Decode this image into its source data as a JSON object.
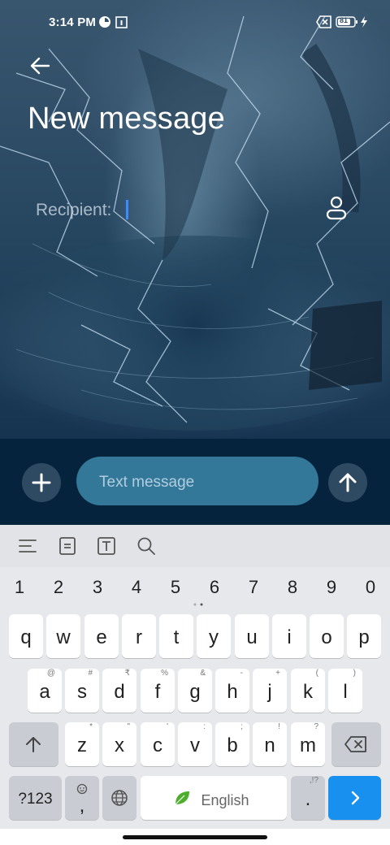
{
  "status_bar": {
    "time": "3:14 PM",
    "battery": "81",
    "icons": [
      "data-saver-icon",
      "calendar-icon",
      "sim-off-icon",
      "battery-icon",
      "charging-icon"
    ]
  },
  "header": {
    "title": "New message",
    "back_icon": "back-arrow-icon"
  },
  "recipient": {
    "label": "Recipient:",
    "value": "",
    "contact_icon": "contact-person-icon"
  },
  "compose": {
    "placeholder": "Text message",
    "attach_icon": "plus-icon",
    "send_icon": "send-arrow-icon"
  },
  "keyboard": {
    "toolbar_icons": [
      "menu-icon",
      "clipboard-icon",
      "text-format-icon",
      "search-icon"
    ],
    "numbers": [
      "1",
      "2",
      "3",
      "4",
      "5",
      "6",
      "7",
      "8",
      "9",
      "0"
    ],
    "row1": [
      "q",
      "w",
      "e",
      "r",
      "t",
      "y",
      "u",
      "i",
      "o",
      "p"
    ],
    "row2": [
      {
        "k": "a",
        "s": "@"
      },
      {
        "k": "s",
        "s": "#"
      },
      {
        "k": "d",
        "s": "₹"
      },
      {
        "k": "f",
        "s": "%"
      },
      {
        "k": "g",
        "s": "&"
      },
      {
        "k": "h",
        "s": "-"
      },
      {
        "k": "j",
        "s": "+"
      },
      {
        "k": "k",
        "s": "("
      },
      {
        "k": "l",
        "s": ")"
      }
    ],
    "row3": [
      {
        "k": "z",
        "s": "*"
      },
      {
        "k": "x",
        "s": "\""
      },
      {
        "k": "c",
        "s": "'"
      },
      {
        "k": "v",
        "s": ":"
      },
      {
        "k": "b",
        "s": ";"
      },
      {
        "k": "n",
        "s": "!"
      },
      {
        "k": "m",
        "s": "?"
      }
    ],
    "sym_key": "?123",
    "comma_key": ",",
    "space_label": "English",
    "period_key": ".",
    "period_sup": ",!?",
    "accent_color": "#1890f0"
  },
  "colors": {
    "compose_bg": "#06233d",
    "field_bg": "#337799",
    "caret": "#3d8bff"
  }
}
